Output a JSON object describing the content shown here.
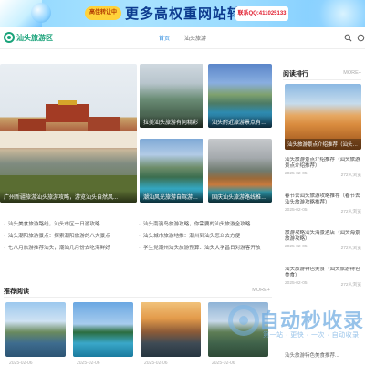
{
  "banner": {
    "badge": "高佳转让中",
    "headline": "更多高权重网站转让",
    "contact": "联系QQ:411025133"
  },
  "header": {
    "logo_text": "汕头旅游区",
    "nav": [
      "首页",
      "汕头旅游"
    ],
    "icons": [
      "search-icon",
      "menu-icon"
    ]
  },
  "featured": {
    "big_caption": "广州新疆旅游汕头旅游攻略，游览汕头自然风...",
    "cards": [
      "拉美汕头旅游有何精彩",
      "汕头附近旅游景点有何好地方",
      "潮汕风光旅游自驾游：关于...",
      "国庆汕头旅游路线推荐攻略，..."
    ]
  },
  "links": [
    [
      "汕头美食旅游路线，汕头市区一日游攻略",
      "汕头南澳岛旅游攻略，你需要的汕头旅游全攻略"
    ],
    [
      "汕头潮阳旅游景点：探索潮阳旅游的八大景点",
      "汕头城市旅游地推：潮州到汕头怎么去方便"
    ],
    [
      "七八月旅游推荐汕头，潮汕几月份去吃海鲜好",
      "学生党潮州汕头旅游预算：汕头大学昌日对游客开放"
    ]
  ],
  "recommended": {
    "title": "推荐阅读",
    "more": "MORE+",
    "dates": [
      "2025-02-06",
      "2025-02-06",
      "2025-02-06",
      "2025-02-06"
    ]
  },
  "sidebar": {
    "title": "阅读排行",
    "more": "MORE+",
    "image_caption": "汕头旅游景点介绍推荐（汕头旅游...",
    "items": [
      {
        "title": "汕头旅游景点介绍推荐（汕头旅游景点介绍推荐）",
        "date": "2025-02-05",
        "views": "272人浏览"
      },
      {
        "title": "春节去汕头旅游攻略推荐（春节去汕头旅游攻略推荐）",
        "date": "2025-02-05",
        "views": "272人浏览"
      },
      {
        "title": "旅游攻略汕头海景酒店（汕头海景旅游攻略）",
        "date": "2025-02-05",
        "views": "272人浏览"
      },
      {
        "title": "汕头旅游特色美食（汕头旅游特色美食）",
        "date": "2025-02-05",
        "views": "272人浏览"
      }
    ],
    "bottom": "汕头旅游特色美食推荐..."
  },
  "watermark": {
    "title": "自动秒收录",
    "subtitle": "第一站 · 更快 · 一次 · 自动收录"
  }
}
